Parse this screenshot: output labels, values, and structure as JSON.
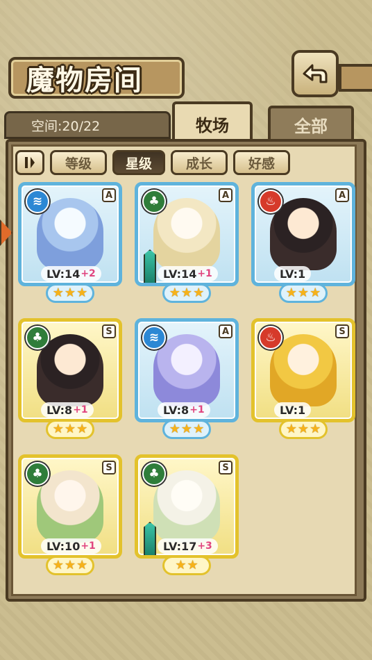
{
  "header": {
    "title": "魔物房间"
  },
  "info": {
    "space_label": "空间:20/22"
  },
  "tabs": [
    {
      "label": "牧场",
      "active": true
    },
    {
      "label": "全部",
      "active": false
    }
  ],
  "sort": {
    "toggle_icon": "sort-order-icon",
    "buttons": [
      {
        "label": "等级",
        "active": false
      },
      {
        "label": "星级",
        "active": true
      },
      {
        "label": "成长",
        "active": false
      },
      {
        "label": "好感",
        "active": false
      }
    ]
  },
  "monsters": [
    {
      "element": "water",
      "rarity": "A",
      "frame": "blue",
      "lv": "LV:14",
      "bonus": "+2",
      "stars": 3,
      "weapon": false,
      "hair": ""
    },
    {
      "element": "plant",
      "rarity": "A",
      "frame": "blue",
      "lv": "LV:14",
      "bonus": "+1",
      "stars": 3,
      "weapon": true,
      "hair": "hair-light"
    },
    {
      "element": "fire",
      "rarity": "A",
      "frame": "blue",
      "lv": "LV:1",
      "bonus": "",
      "stars": 3,
      "weapon": false,
      "hair": "hair-dark"
    },
    {
      "element": "plant",
      "rarity": "S",
      "frame": "gold",
      "lv": "LV:8",
      "bonus": "+1",
      "stars": 3,
      "weapon": false,
      "hair": "hair-dark"
    },
    {
      "element": "water",
      "rarity": "A",
      "frame": "blue",
      "lv": "LV:8",
      "bonus": "+1",
      "stars": 3,
      "weapon": false,
      "hair": "hair-crystal"
    },
    {
      "element": "fire",
      "rarity": "S",
      "frame": "gold",
      "lv": "LV:1",
      "bonus": "",
      "stars": 3,
      "weapon": false,
      "hair": "hair-blonde"
    },
    {
      "element": "plant",
      "rarity": "S",
      "frame": "gold",
      "lv": "LV:10",
      "bonus": "+1",
      "stars": 3,
      "weapon": false,
      "hair": "hair-pink"
    },
    {
      "element": "plant",
      "rarity": "S",
      "frame": "gold",
      "lv": "LV:17",
      "bonus": "+3",
      "stars": 2,
      "weapon": true,
      "hair": "hair-white"
    }
  ],
  "icons": {
    "back": "back-arrow-icon",
    "water": "water-element-icon",
    "plant": "plant-element-icon",
    "fire": "fire-element-icon"
  }
}
